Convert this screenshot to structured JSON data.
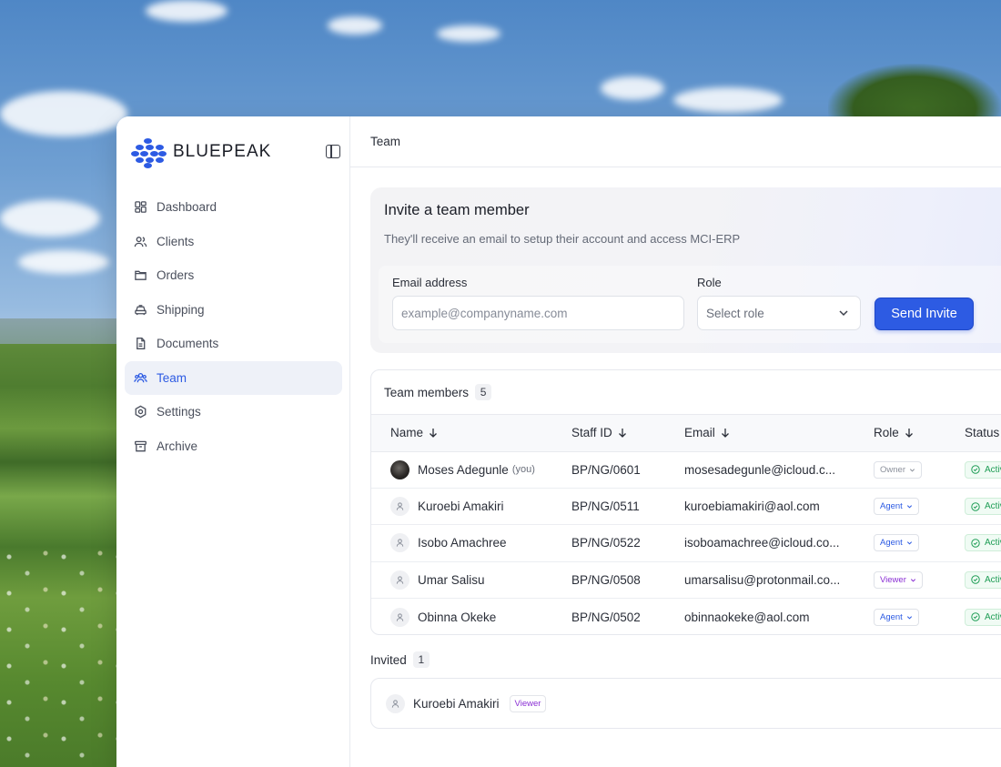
{
  "brand": {
    "name": "BLUEPEAK"
  },
  "sidebar": {
    "items": [
      {
        "label": "Dashboard",
        "icon": "dashboard-icon",
        "active": false
      },
      {
        "label": "Clients",
        "icon": "users-icon",
        "active": false
      },
      {
        "label": "Orders",
        "icon": "folder-icon",
        "active": false
      },
      {
        "label": "Shipping",
        "icon": "truck-icon",
        "active": false
      },
      {
        "label": "Documents",
        "icon": "document-icon",
        "active": false
      },
      {
        "label": "Team",
        "icon": "team-icon",
        "active": true
      },
      {
        "label": "Settings",
        "icon": "gear-icon",
        "active": false
      },
      {
        "label": "Archive",
        "icon": "archive-icon",
        "active": false
      }
    ]
  },
  "header": {
    "title": "Team"
  },
  "invite": {
    "title": "Invite a team member",
    "subtitle": "They'll receive an email to setup their account and access MCI-ERP",
    "email_label": "Email address",
    "email_placeholder": "example@companyname.com",
    "role_label": "Role",
    "role_placeholder": "Select role",
    "send_label": "Send Invite"
  },
  "members": {
    "title": "Team members",
    "count": "5",
    "columns": [
      "Name",
      "Staff ID",
      "Email",
      "Role",
      "Status"
    ],
    "rows": [
      {
        "name": "Moses Adegunle",
        "you": "(you)",
        "staff_id": "BP/NG/0601",
        "email": "mosesadegunle@icloud.c...",
        "role": "Owner",
        "status": "Activ",
        "avatar": "photo"
      },
      {
        "name": "Kuroebi Amakiri",
        "you": "",
        "staff_id": "BP/NG/0511",
        "email": "kuroebiamakiri@aol.com",
        "role": "Agent",
        "status": "Activ",
        "avatar": "placeholder"
      },
      {
        "name": "Isobo Amachree",
        "you": "",
        "staff_id": "BP/NG/0522",
        "email": "isoboamachree@icloud.co...",
        "role": "Agent",
        "status": "Activ",
        "avatar": "placeholder"
      },
      {
        "name": "Umar Salisu",
        "you": "",
        "staff_id": "BP/NG/0508",
        "email": "umarsalisu@protonmail.co...",
        "role": "Viewer",
        "status": "Activ",
        "avatar": "placeholder"
      },
      {
        "name": "Obinna Okeke",
        "you": "",
        "staff_id": "BP/NG/0502",
        "email": "obinnaokeke@aol.com",
        "role": "Agent",
        "status": "Activ",
        "avatar": "placeholder"
      }
    ]
  },
  "invited": {
    "title": "Invited",
    "count": "1",
    "items": [
      {
        "name": "Kuroebi Amakiri",
        "role": "Viewer"
      }
    ]
  },
  "colors": {
    "accent": "#2d5be3",
    "viewer": "#8a2fd4",
    "status_active": "#1e9d55"
  }
}
